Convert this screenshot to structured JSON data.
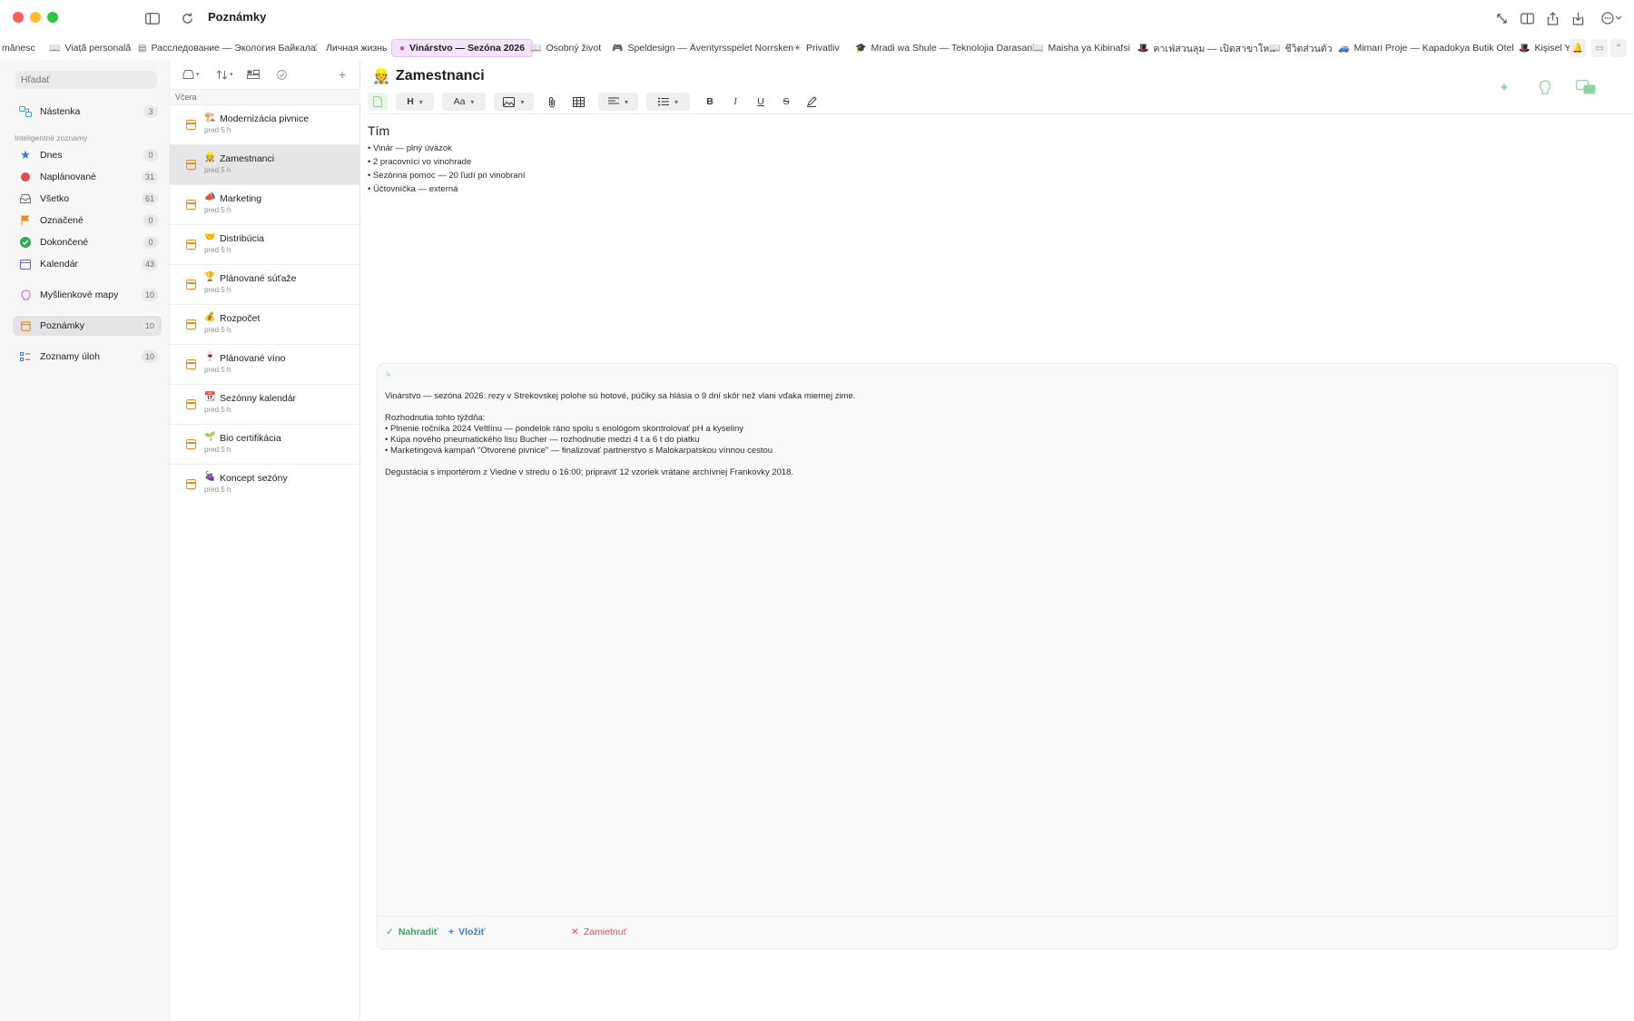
{
  "window": {
    "title": "Poznámky"
  },
  "tabs": [
    {
      "label": "mănesc",
      "icon": ""
    },
    {
      "label": "Viață personală",
      "icon": "book-icon"
    },
    {
      "label": "Расследование — Экология Байкала",
      "icon": "doc-icon"
    },
    {
      "label": "Личная жизнь",
      "icon": "moon-icon"
    },
    {
      "label": "Vinárstvo — Sezóna 2026",
      "icon": "pin-icon",
      "active": true
    },
    {
      "label": "Osobný život",
      "icon": "book-icon"
    },
    {
      "label": "Speldesign — Äventyrsspelet Norrsken",
      "icon": "gamepad-icon"
    },
    {
      "label": "Privatliv",
      "icon": "sun-icon"
    },
    {
      "label": "Mradi wa Shule — Teknolojia Darasani",
      "icon": "graduation-icon"
    },
    {
      "label": "Maisha ya Kibinafsi",
      "icon": "book-icon"
    },
    {
      "label": "คาเฟ่สวนลุม — เปิดสาขาใหม่",
      "icon": "hat-icon"
    },
    {
      "label": "ชีวิตส่วนตัว",
      "icon": "book-icon"
    },
    {
      "label": "Mimari Proje — Kapadokya Butik Otel",
      "icon": "car-icon"
    },
    {
      "label": "Kişisel Y",
      "icon": "hat-icon"
    }
  ],
  "sidebar": {
    "search_placeholder": "Hľadať",
    "section_label": "Inteligentné zoznamy",
    "items": [
      {
        "label": "Nástenka",
        "count": "3",
        "icon": "board-icon"
      },
      {
        "label": "Dnes",
        "count": "0",
        "icon": "star-icon"
      },
      {
        "label": "Naplánované",
        "count": "31",
        "icon": "calendar-red-icon"
      },
      {
        "label": "Všetko",
        "count": "61",
        "icon": "tray-icon"
      },
      {
        "label": "Označené",
        "count": "0",
        "icon": "flag-icon"
      },
      {
        "label": "Dokončené",
        "count": "0",
        "icon": "check-circle-icon"
      },
      {
        "label": "Kalendár",
        "count": "43",
        "icon": "calendar-icon"
      },
      {
        "label": "Myšlienkové mapy",
        "count": "10",
        "icon": "brain-icon"
      },
      {
        "label": "Poznámky",
        "count": "10",
        "icon": "note-icon",
        "selected": true
      },
      {
        "label": "Zoznamy úloh",
        "count": "10",
        "icon": "checklist-icon"
      }
    ]
  },
  "notelist": {
    "group_label": "Včera",
    "notes": [
      {
        "emoji": "🏗️",
        "title": "Modernizácia pivnice",
        "time": "pred 5 h"
      },
      {
        "emoji": "👷",
        "title": "Zamestnanci",
        "time": "pred 5 h",
        "selected": true
      },
      {
        "emoji": "📣",
        "title": "Marketing",
        "time": "pred 5 h"
      },
      {
        "emoji": "🤝",
        "title": "Distribúcia",
        "time": "pred 5 h"
      },
      {
        "emoji": "🏆",
        "title": "Plánované súťaže",
        "time": "pred 5 h"
      },
      {
        "emoji": "💰",
        "title": "Rozpočet",
        "time": "pred 5 h"
      },
      {
        "emoji": "🍷",
        "title": "Plánované víno",
        "time": "pred 5 h"
      },
      {
        "emoji": "📆",
        "title": "Sezónny kalendár",
        "time": "pred 5 h"
      },
      {
        "emoji": "🌱",
        "title": "Bio certifikácia",
        "time": "pred 5 h"
      },
      {
        "emoji": "🍇",
        "title": "Koncept sezóny",
        "time": "pred 5 h"
      }
    ]
  },
  "editor": {
    "title_emoji": "👷",
    "title": "Zamestnanci",
    "toolbar": {
      "heading": "H",
      "font": "Aa",
      "bold": "B",
      "italic": "I",
      "underline": "U",
      "strike": "S"
    },
    "heading": "Tím",
    "items": [
      "• Vinár — plný úväzok",
      "• 2 pracovníci vo vinohrade",
      "• Sezónna pomoc — 20 ľudí pri vinobraní",
      "• Účtovníčka — externá"
    ]
  },
  "ai_panel": {
    "lines": [
      "Vinárstvo — sezóna 2026: rezy v Strekovskej polohe sú hotové, púčiky sa hlásia o 9 dní skôr než vlani vďaka miernej zime.",
      "",
      "Rozhodnutia tohto týždňa:",
      "• Plnenie ročníka 2024 Veltlínu — pondelok ráno spolu s enológom skontrolovať pH a kyseliny",
      "• Kúpa nového pneumatického lisu Bucher — rozhodnutie medzi 4 t a 6 t do piatku",
      "• Marketingová kampaň \"Otvorené pivnice\" — finalizovať partnerstvo s Malokarpatskou vínnou cestou",
      "",
      "Degustácia s importérom z Viedne v stredu o 16:00; pripraviť 12 vzoriek vrátane archívnej Frankovky 2018."
    ],
    "replace_label": "Nahradiť",
    "insert_label": "Vložiť",
    "reject_label": "Zamietnuť"
  },
  "colors": {
    "accent_active_tab": "#f3e4f9",
    "replace": "#34a853",
    "insert": "#2f7de1",
    "reject": "#e5484d",
    "note_icon": "#f08a24"
  }
}
